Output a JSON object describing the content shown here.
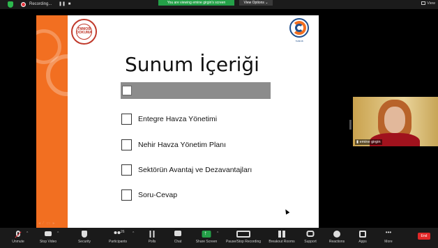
{
  "top_bar": {
    "recording_label": "Recording...",
    "pause_glyph": "❚❚",
    "stop_glyph": "■",
    "viewing_banner": "You are viewing emine girgin's screen",
    "view_options": "View Options ⌄",
    "view_label": "View"
  },
  "slide": {
    "left_logo_text": "TMMOB DOKUMA",
    "right_logo_caption": "TMMOB",
    "title": "Sunum İçeriği",
    "items": [
      "Entegre Havza Yönetimi",
      "Nehir Havza Yönetim Planı",
      "Sektörün Avantaj ve Dezavantajları",
      "Soru-Cevap"
    ],
    "nav_glyphs": "◂ ⁄ ▭ ▸"
  },
  "participant": {
    "name": "emine girgin",
    "signal_glyph": "📶"
  },
  "toolbar": {
    "participants_count": "26",
    "buttons": [
      {
        "label": "Unmute",
        "icon": "mic-muted-icon"
      },
      {
        "label": "Stop Video",
        "icon": "camera-icon"
      },
      {
        "label": "Security",
        "icon": "shield-icon"
      },
      {
        "label": "Participants",
        "icon": "people-icon"
      },
      {
        "label": "Polls",
        "icon": "polls-icon"
      },
      {
        "label": "Chat",
        "icon": "chat-icon"
      },
      {
        "label": "Share Screen",
        "icon": "share-screen-icon"
      },
      {
        "label": "Pause/Stop Recording",
        "icon": "recording-icon"
      },
      {
        "label": "Breakout Rooms",
        "icon": "breakout-rooms-icon"
      },
      {
        "label": "Support",
        "icon": "support-icon"
      },
      {
        "label": "Reactions",
        "icon": "reactions-icon"
      },
      {
        "label": "Apps",
        "icon": "apps-icon"
      },
      {
        "label": "More",
        "icon": "more-icon"
      }
    ],
    "end_label": "End"
  },
  "colors": {
    "slide_orange": "#f26f21",
    "share_green": "#24a048",
    "end_red": "#e02828"
  }
}
